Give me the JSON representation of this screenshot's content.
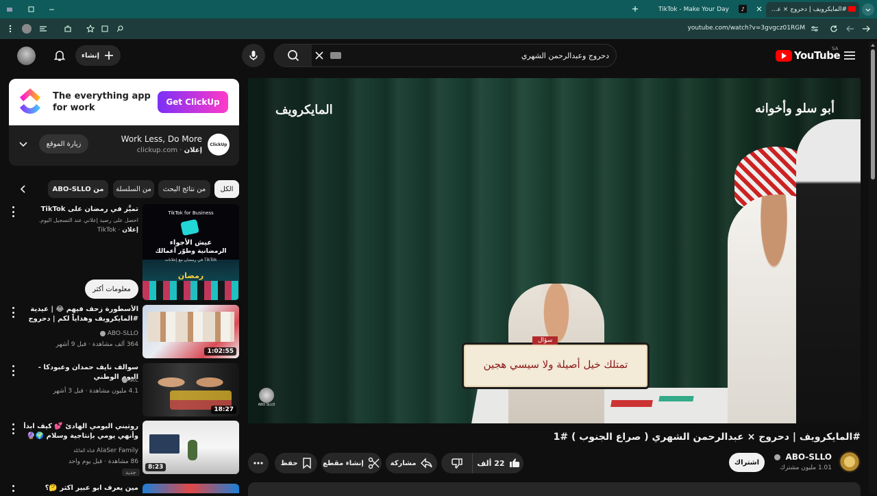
{
  "browser": {
    "tabs": [
      {
        "title": "#المايكرويف | دحروج × عبدالرحمـ...",
        "active": true
      },
      {
        "title": "TikTok - Make Your Day",
        "active": false
      }
    ],
    "url": "youtube.com/watch?v=3gvgcz01RGM"
  },
  "header": {
    "logo_text": "YouTube",
    "region": "SA",
    "search_value": "دحروج وعبدالرحمن الشهري",
    "create_label": "إنشاء"
  },
  "ad": {
    "banner_headline": "The everything app for work",
    "banner_cta": "Get ClickUp",
    "title": "Work Less, Do More",
    "sponsor": "إعلان",
    "domain": "clickup.com",
    "visit_label": "زيارة الموقع",
    "logo_label": "ClickUp"
  },
  "chips": [
    "الكل",
    "من نتائج البحث",
    "من السلسلة",
    "من ABO-SLLO"
  ],
  "tiktok_ad": {
    "title": "تميَّز في رمضان على TikTok",
    "desc": "احصل على رصيد إعلاني عند التسجيل اليوم.",
    "sponsor": "إعلان",
    "advertiser": "TikTok",
    "more_label": "معلومات أكثر",
    "thumb_brand": "TikTok for Business",
    "thumb_line1": "عيش الأجواء",
    "thumb_line2": "الرمضانية وطوّر أعمالك",
    "thumb_line3": "في رمضان مع إعلانات TikTok",
    "thumb_logo": "رمضان"
  },
  "recommendations": [
    {
      "title": "الأسطورة زحف فيهم 😂 | عيدية #المايكرويف وهداياً لكم | دحروج x ...",
      "channel": "ABO-SLLO",
      "views": "364 ألف مشاهدة",
      "age": "قبل 9 أشهر",
      "duration": "1:02:55"
    },
    {
      "title": "سوالف نايف حمدان وعبودكا - اليوم الوطني",
      "channel": "stc",
      "views": "4.1 مليون مشاهدة",
      "age": "قبل 3 أشهر",
      "duration": "18:27"
    },
    {
      "title": "روتيني اليومي الهادئ 💕 كيف ابدأ وأنهي يومي بإنتاجية وسلام 🌍🔮",
      "channel": "AlaSer Family",
      "channel_suffix": "قناة العائلة",
      "views": "86 مشاهدة",
      "age": "قبل يوم واحد",
      "duration": "8:23",
      "badge": "جديد"
    },
    {
      "title": "مين يعرف ابو عبير اكثر 🤔؟",
      "channel": "",
      "views": "",
      "age": "",
      "duration": ""
    }
  ],
  "video": {
    "title": "#المايكرويف | دحروج × عبدالرحمن الشهري ( صراع الجنوب ) #1",
    "channel": "ABO-SLLO",
    "subscribers": "1.01 مليون مشترك",
    "subscribe_label": "اشتراك",
    "likes": "22 ألف",
    "share_label": "مشاركة",
    "clip_label": "إنشاء مقطع",
    "save_label": "حفظ",
    "overlay_left": "المايكرويف",
    "overlay_right": "أبو سلو وأخوانه",
    "card_tag": "سؤال",
    "card_text": "تمتلك خيل أصيلة ولا سيسي هجين",
    "watermark": "ABO SLLO"
  }
}
